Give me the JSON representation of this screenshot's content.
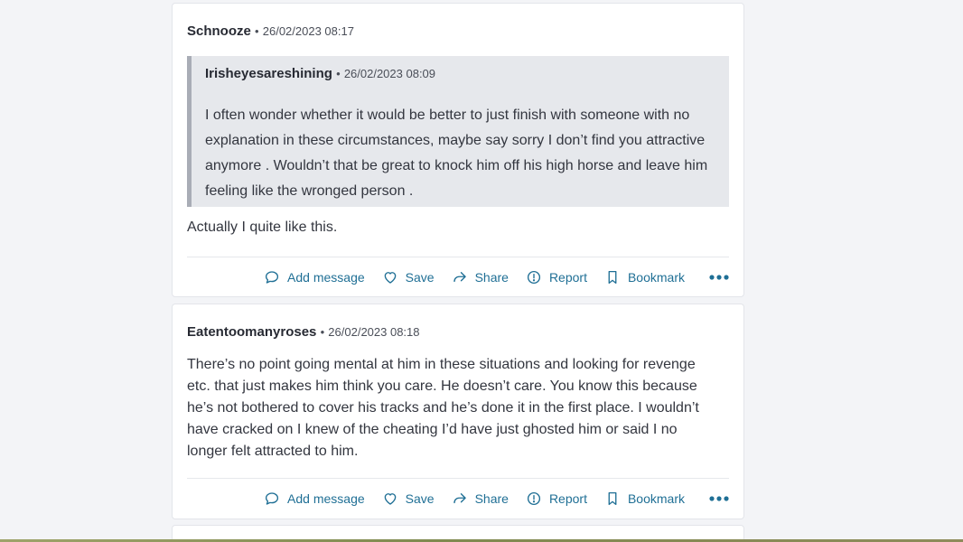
{
  "posts": [
    {
      "author": "Schnooze",
      "separator": "•",
      "timestamp": "26/02/2023 08:17",
      "quote": {
        "author": "Irisheyesareshining",
        "separator": "•",
        "timestamp": "26/02/2023 08:09",
        "body": "I often wonder whether it would be better to just finish with someone with no explanation in these circumstances, maybe say sorry I don’t find you attractive anymore . Wouldn’t that be great to knock him off his high horse and leave him feeling like the wronged person ."
      },
      "body": "Actually I quite like this.",
      "actions": {
        "add_message": "Add message",
        "save": "Save",
        "share": "Share",
        "report": "Report",
        "bookmark": "Bookmark"
      }
    },
    {
      "author": "Eatentoomanyroses",
      "separator": "•",
      "timestamp": "26/02/2023 08:18",
      "body": "There’s no point going mental at him in these situations and looking for revenge etc. that just makes him think you care. He doesn’t care. You know this because he’s not bothered to cover his tracks and he’s done it in the first place. I wouldn’t have cracked on I knew of the cheating I’d have just ghosted him or said I no longer felt attracted to him.",
      "actions": {
        "add_message": "Add message",
        "save": "Save",
        "share": "Share",
        "report": "Report",
        "bookmark": "Bookmark"
      }
    }
  ],
  "icons": {
    "add_message": "speech-bubble-icon",
    "save": "heart-icon",
    "share": "share-arrow-icon",
    "report": "info-circle-icon",
    "bookmark": "bookmark-icon",
    "more": "more-dots-icon"
  },
  "colors": {
    "page_background": "#f3f4f7",
    "card_background": "#ffffff",
    "quote_background": "#e6e8ec",
    "quote_border": "#a9adb6",
    "action_link": "#1f6f95",
    "text": "#33363f"
  }
}
